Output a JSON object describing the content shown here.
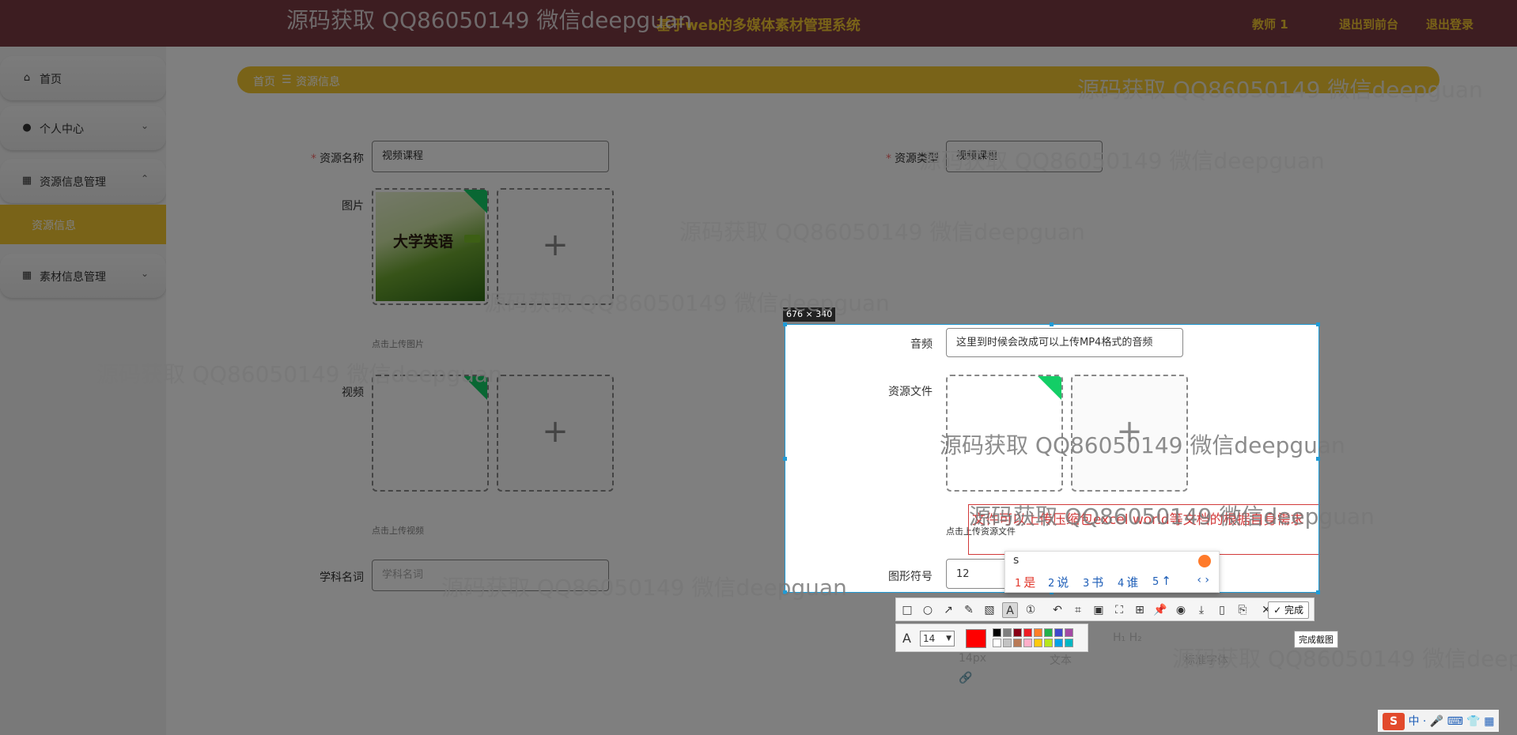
{
  "header": {
    "app_title": "基于web的多媒体素材管理系统",
    "user": "教师 1",
    "back_to_front": "退出到前台",
    "logout": "退出登录"
  },
  "sidebar": {
    "items": [
      {
        "icon": "home-icon",
        "label": "首页"
      },
      {
        "icon": "user-icon",
        "label": "个人中心"
      },
      {
        "icon": "grid-icon",
        "label": "资源信息管理"
      },
      {
        "icon": "grid-icon",
        "label": "素材信息管理"
      }
    ],
    "active_sub": "资源信息"
  },
  "breadcrumb": {
    "home": "首页",
    "sep": "☰",
    "current": "资源信息"
  },
  "form": {
    "name_label": "资源名称",
    "name_value": "视频课程",
    "type_label": "资源类型",
    "type_value": "视频课程",
    "image_label": "图片",
    "image_hint": "点击上传图片",
    "book_title": "大学英语",
    "video_label": "视频",
    "video_hint": "点击上传视频",
    "subject_label": "学科名词",
    "subject_placeholder": "学科名词",
    "audio_label": "音频",
    "audio_value": "这里到时候会改成可以上传MP4格式的音频",
    "file_label": "资源文件",
    "file_hint": "点击上传资源文件",
    "symbol_label": "图形符号",
    "symbol_value": "12"
  },
  "screenshot": {
    "size_label": "676 × 340",
    "annotation": "文件可以上传压缩包excel world等文档的根据自身需求",
    "font_size": "14",
    "current_color": "#ff0000",
    "done_label": "完成",
    "tooltip": "完成截图"
  },
  "ime": {
    "input": "s",
    "candidates": [
      {
        "num": "1",
        "text": "是"
      },
      {
        "num": "2",
        "text": "说"
      },
      {
        "num": "3",
        "text": "书"
      },
      {
        "num": "4",
        "text": "谁"
      },
      {
        "num": "5",
        "text": "↑"
      }
    ],
    "pager": "‹ ›"
  },
  "editor": {
    "font_size": "14px",
    "text_style": "文本",
    "text_style2": "标准字体"
  },
  "watermark": "源码获取 QQ86050149 微信deepguan",
  "palette": [
    "#000000",
    "#7f7f7f",
    "#880015",
    "#ed1c24",
    "#ff7f27",
    "#22b14c",
    "#3f48cc",
    "#a349a4",
    "#ffffff",
    "#c3c3c3",
    "#b97a57",
    "#ffaec9",
    "#ffc90e",
    "#b5e61d",
    "#00a2e8",
    "#00b7c3"
  ]
}
